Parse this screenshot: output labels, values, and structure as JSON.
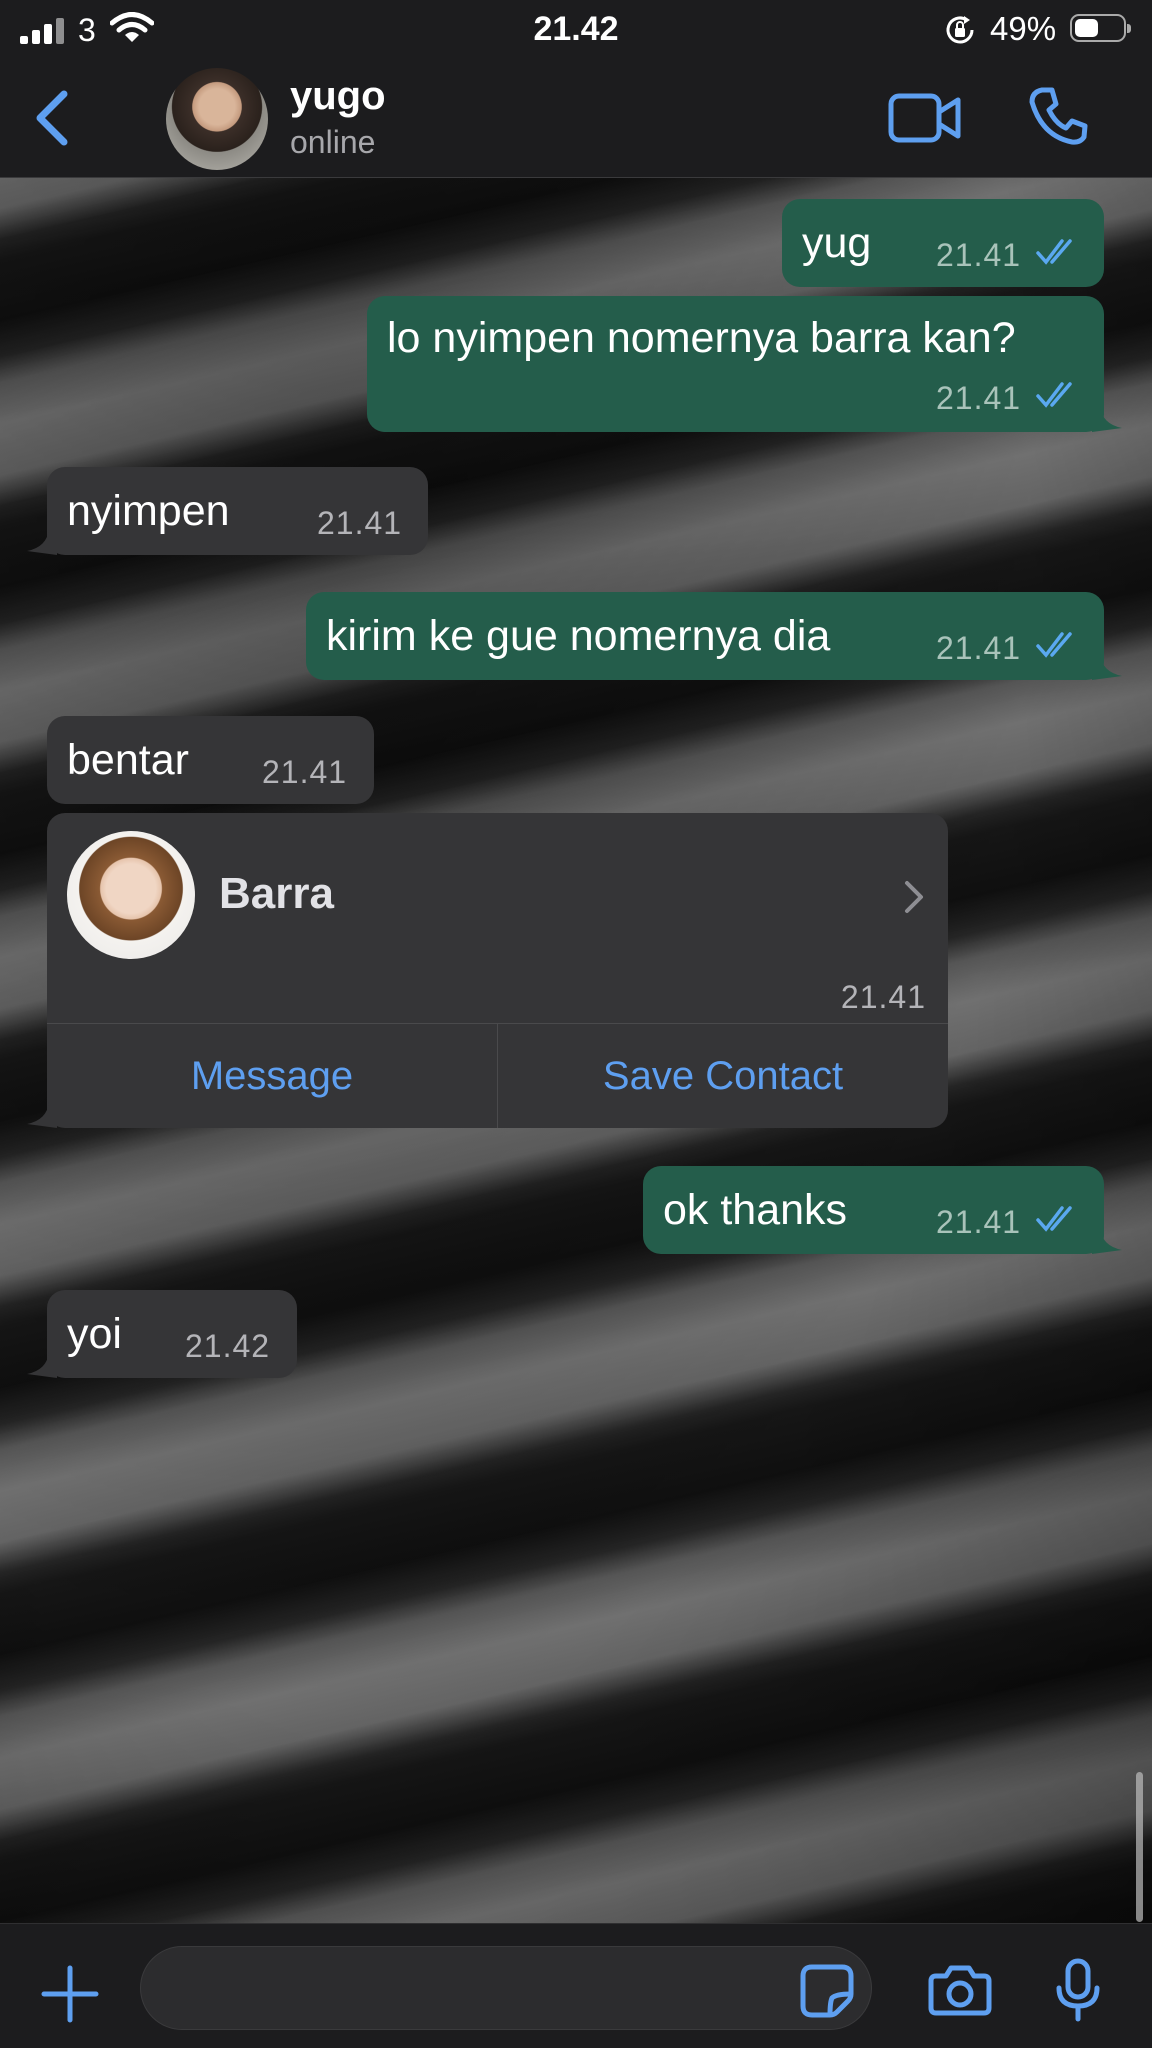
{
  "status_bar": {
    "carrier": "3",
    "time": "21.42",
    "battery_percent": "49%",
    "battery_level": 0.49
  },
  "header": {
    "back_icon": "chevron-left-icon",
    "contact_name": "yugo",
    "contact_status": "online",
    "video_icon": "video-camera-icon",
    "call_icon": "phone-icon"
  },
  "messages": [
    {
      "direction": "out",
      "text": "yug",
      "time": "21.41",
      "read": true
    },
    {
      "direction": "out",
      "text": "lo nyimpen nomernya barra kan?",
      "time": "21.41",
      "read": true
    },
    {
      "direction": "in",
      "text": "nyimpen",
      "time": "21.41"
    },
    {
      "direction": "out",
      "text": "kirim ke gue nomernya dia",
      "time": "21.41",
      "read": true
    },
    {
      "direction": "in",
      "text": "bentar",
      "time": "21.41"
    },
    {
      "direction": "out",
      "text": "ok thanks",
      "time": "21.41",
      "read": true
    },
    {
      "direction": "in",
      "text": "yoi",
      "time": "21.42"
    }
  ],
  "contact_card": {
    "name": "Barra",
    "time": "21.41",
    "message_button": "Message",
    "save_button": "Save Contact"
  },
  "input_bar": {
    "placeholder": "",
    "attach_icon": "plus-icon",
    "sticker_icon": "sticker-icon",
    "camera_icon": "camera-icon",
    "mic_icon": "microphone-icon"
  },
  "colors": {
    "outgoing_bubble": "#245d4b",
    "incoming_bubble": "#353537",
    "accent": "#5e9ff0",
    "read_ticks": "#5aa8f0"
  }
}
